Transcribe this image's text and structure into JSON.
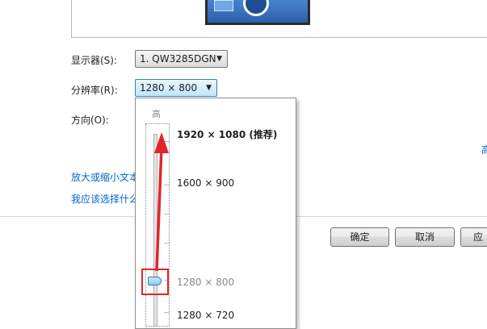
{
  "display": {
    "monitor_label": "显示器(S):",
    "monitor_value": "1. QW3285DGN",
    "resolution_label": "分辨率(R):",
    "resolution_value": "1280 × 800",
    "orientation_label": "方向(O):"
  },
  "dropdown": {
    "high_label": "高",
    "options": [
      {
        "label": "1920 × 1080 (推荐)"
      },
      {
        "label": "1600 × 900"
      },
      {
        "label": "1280 × 800"
      },
      {
        "label": "1280 × 720"
      }
    ],
    "selected_index": 2
  },
  "links": {
    "enlarge_text": "放大或缩小文本",
    "which_settings": "我应该选择什么",
    "advanced_partial": "高"
  },
  "buttons": {
    "ok": "确定",
    "cancel": "取消",
    "apply": "应用"
  },
  "colors": {
    "annotation_red": "#e0262b",
    "link_blue": "#0066cc",
    "combo_active": "#bee6fd"
  }
}
